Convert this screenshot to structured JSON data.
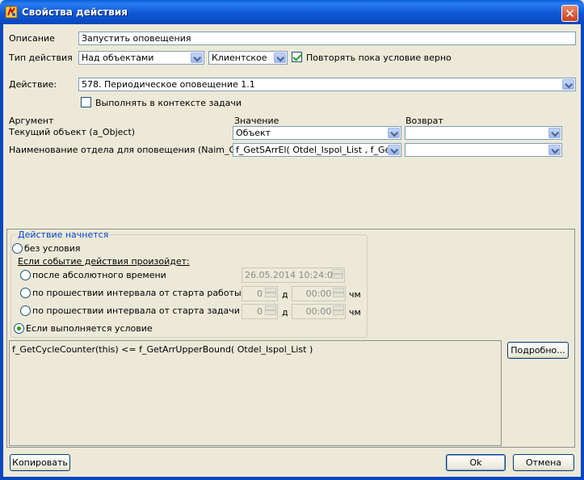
{
  "window": {
    "title": "Свойства действия",
    "close": "✕"
  },
  "form": {
    "description_label": "Описание",
    "description_value": "Запустить оповещения",
    "action_type_label": "Тип действия",
    "action_type_value": "Над объектами",
    "side_value": "Клиентское",
    "repeat_label": "Повторять пока условие верно",
    "repeat_checked": true,
    "action_label": "Действие:",
    "action_value": "578. Периодическое оповещение 1.1",
    "task_context_label": "Выполнять в контексте задачи",
    "task_context_checked": false
  },
  "args": {
    "col_argument": "Аргумент",
    "col_value": "Значение",
    "col_return": "Возврат",
    "rows": [
      {
        "name": "Текущий объект (a_Object)",
        "value": "Объект",
        "ret": ""
      },
      {
        "name": "Наименование отдела для оповещения (Naim_Otdel)",
        "value": "f_GetSArrEl( Otdel_Ispol_List , f_GetCycleCounter(this) )",
        "ret": ""
      }
    ]
  },
  "start": {
    "group_title": "Действие начнется",
    "no_condition": "без условия",
    "if_event": "Если событие действия произойдет:",
    "after_abs_time": "после абсолютного времени",
    "abs_time_value": "26.05.2014 10:24:00",
    "after_work_start": "по прошествии интервала от старта работы",
    "after_task_start": "по прошествии интервала от старта задачи",
    "days_value": "0",
    "days_unit": "д",
    "time_value": "00:00",
    "time_unit": "чм",
    "if_condition": "Если выполняется условие",
    "selected": "if_condition",
    "condition_text": "f_GetCycleCounter(this) <= f_GetArrUpperBound( Otdel_Ispol_List )",
    "details_button": "Подробно..."
  },
  "buttons": {
    "copy": "Копировать",
    "ok": "Ok",
    "cancel": "Отмена"
  },
  "icons": {
    "app": "app-icon",
    "close": "close-icon",
    "dropdown": "chevron-down-icon"
  }
}
